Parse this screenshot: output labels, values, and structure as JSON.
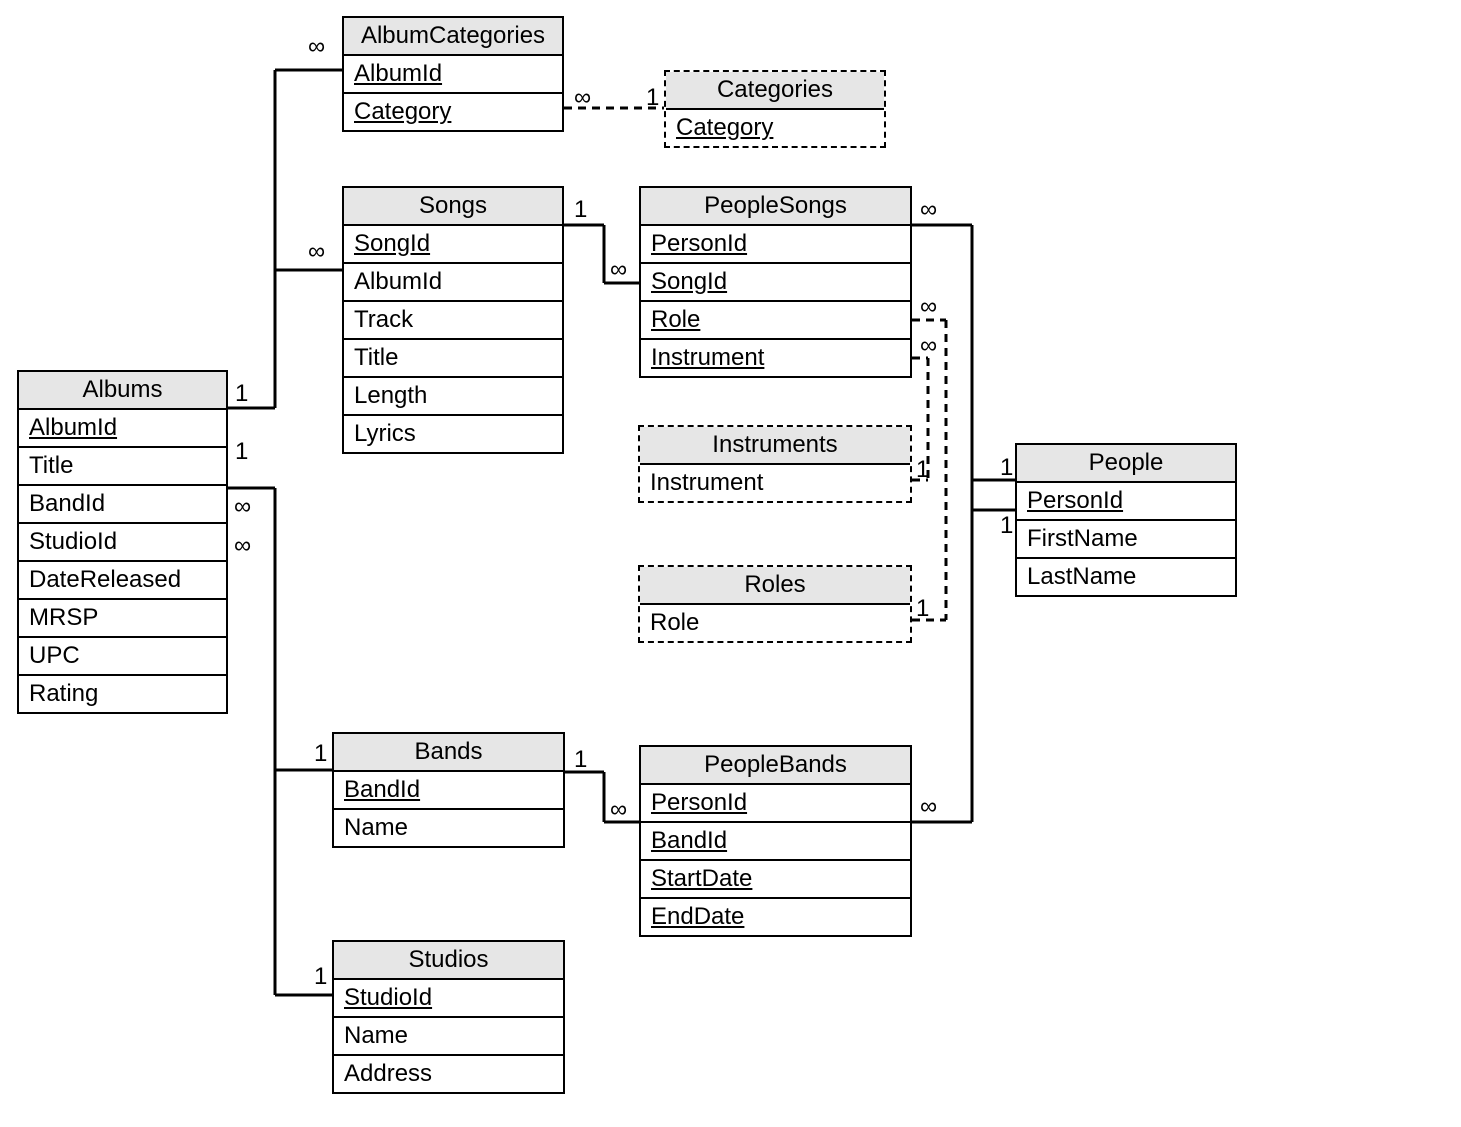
{
  "tables": {
    "Albums": {
      "title": "Albums",
      "fields": [
        "AlbumId",
        "Title",
        "BandId",
        "StudioId",
        "DateReleased",
        "MRSP",
        "UPC",
        "Rating"
      ],
      "pk": [
        0
      ]
    },
    "AlbumCategories": {
      "title": "AlbumCategories",
      "fields": [
        "AlbumId",
        "Category"
      ],
      "pk": [
        0,
        1
      ]
    },
    "Categories": {
      "title": "Categories",
      "fields": [
        "Category"
      ],
      "pk": [
        0
      ]
    },
    "Songs": {
      "title": "Songs",
      "fields": [
        "SongId",
        "AlbumId",
        "Track",
        "Title",
        "Length",
        "Lyrics"
      ],
      "pk": [
        0
      ]
    },
    "PeopleSongs": {
      "title": "PeopleSongs",
      "fields": [
        "PersonId",
        "SongId",
        "Role",
        "Instrument"
      ],
      "pk": [
        0,
        1,
        2,
        3
      ]
    },
    "Instruments": {
      "title": "Instruments",
      "fields": [
        "Instrument"
      ],
      "pk": []
    },
    "Roles": {
      "title": "Roles",
      "fields": [
        "Role"
      ],
      "pk": []
    },
    "Bands": {
      "title": "Bands",
      "fields": [
        "BandId",
        "Name"
      ],
      "pk": [
        0
      ]
    },
    "PeopleBands": {
      "title": "PeopleBands",
      "fields": [
        "PersonId",
        "BandId",
        "StartDate",
        "EndDate"
      ],
      "pk": [
        0,
        1,
        2,
        3
      ]
    },
    "Studios": {
      "title": "Studios",
      "fields": [
        "StudioId",
        "Name",
        "Address"
      ],
      "pk": [
        0
      ]
    },
    "People": {
      "title": "People",
      "fields": [
        "PersonId",
        "FirstName",
        "LastName"
      ],
      "pk": [
        0
      ]
    }
  },
  "cardinality": {
    "one": "1",
    "many": "∞"
  },
  "relationships": [
    {
      "from": "Albums.AlbumId",
      "to": "AlbumCategories.AlbumId",
      "card": [
        "1",
        "∞"
      ],
      "style": "solid"
    },
    {
      "from": "AlbumCategories.Category",
      "to": "Categories.Category",
      "card": [
        "∞",
        "1"
      ],
      "style": "dashed"
    },
    {
      "from": "Albums.AlbumId",
      "to": "Songs.AlbumId",
      "card": [
        "1",
        "∞"
      ],
      "style": "solid"
    },
    {
      "from": "Songs.SongId",
      "to": "PeopleSongs.SongId",
      "card": [
        "1",
        "∞"
      ],
      "style": "solid"
    },
    {
      "from": "PeopleSongs.PersonId",
      "to": "People.PersonId",
      "card": [
        "∞",
        "1"
      ],
      "style": "solid"
    },
    {
      "from": "PeopleSongs.Instrument",
      "to": "Instruments.Instrument",
      "card": [
        "∞",
        "1"
      ],
      "style": "dashed"
    },
    {
      "from": "PeopleSongs.Role",
      "to": "Roles.Role",
      "card": [
        "∞",
        "1"
      ],
      "style": "dashed"
    },
    {
      "from": "Albums.BandId",
      "to": "Bands.BandId",
      "card": [
        "∞",
        "1"
      ],
      "style": "solid"
    },
    {
      "from": "Bands.BandId",
      "to": "PeopleBands.BandId",
      "card": [
        "1",
        "∞"
      ],
      "style": "solid"
    },
    {
      "from": "PeopleBands.PersonId",
      "to": "People.PersonId",
      "card": [
        "∞",
        "1"
      ],
      "style": "solid"
    },
    {
      "from": "Albums.StudioId",
      "to": "Studios.StudioId",
      "card": [
        "∞",
        "1"
      ],
      "style": "solid"
    }
  ]
}
